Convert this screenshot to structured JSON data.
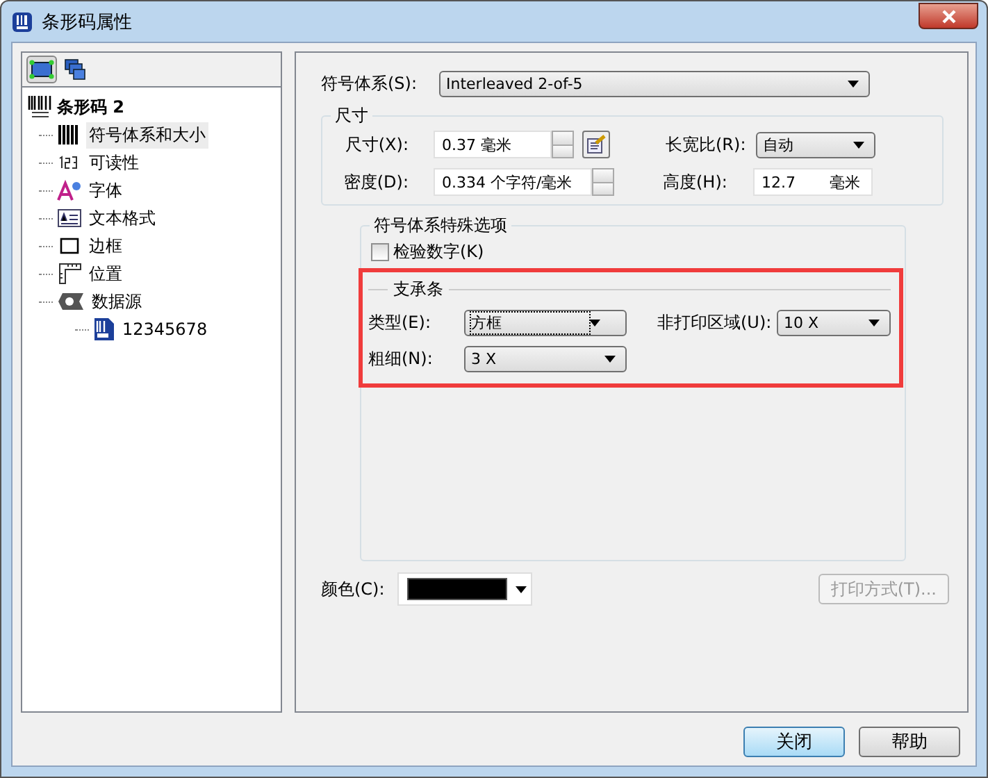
{
  "window": {
    "title": "条形码属性"
  },
  "toolbar": [
    {
      "kind": "object",
      "selected": true
    },
    {
      "kind": "layers",
      "selected": false
    }
  ],
  "tree": {
    "label": "条形码 2",
    "kind": "barcode",
    "children": [
      {
        "label": "符号体系和大小",
        "kind": "bars",
        "selected": true
      },
      {
        "label": "可读性",
        "kind": "digits",
        "selected": false
      },
      {
        "label": "字体",
        "kind": "font",
        "selected": false
      },
      {
        "label": "文本格式",
        "kind": "textformat",
        "selected": false
      },
      {
        "label": "边框",
        "kind": "border",
        "selected": false
      },
      {
        "label": "位置",
        "kind": "position",
        "selected": false
      },
      {
        "label": "数据源",
        "kind": "datasource",
        "selected": false,
        "children": [
          {
            "label": "12345678",
            "kind": "document",
            "selected": false
          }
        ]
      }
    ]
  },
  "symbology": {
    "label": "符号体系(S):",
    "value": "Interleaved 2-of-5"
  },
  "size_group": {
    "title": "尺寸",
    "size": {
      "label": "尺寸(X):",
      "value": "0.37 毫米"
    },
    "ratio": {
      "label": "长宽比(R):",
      "value": "自动"
    },
    "density": {
      "label": "密度(D):",
      "value": "0.334  个字符/毫米"
    },
    "height": {
      "label": "高度(H):",
      "value": "12.7",
      "unit": "毫米"
    }
  },
  "special_group": {
    "title": "符号体系特殊选项",
    "check_digit": {
      "label": "检验数字(K)",
      "checked": false
    },
    "bearer": {
      "title": "支承条",
      "type": {
        "label": "类型(E):",
        "value": "方框",
        "focused": true
      },
      "quiet_zone": {
        "label": "非打印区域(U):",
        "value": "10 X"
      },
      "thickness": {
        "label": "粗细(N):",
        "value": "3  X"
      }
    }
  },
  "color": {
    "label": "颜色(C):",
    "color": "#000000"
  },
  "print_mode_button": {
    "label": "打印方式(T)...",
    "disabled": true
  },
  "buttons": [
    {
      "label": "关闭",
      "default": true
    },
    {
      "label": "帮助",
      "default": false
    }
  ]
}
